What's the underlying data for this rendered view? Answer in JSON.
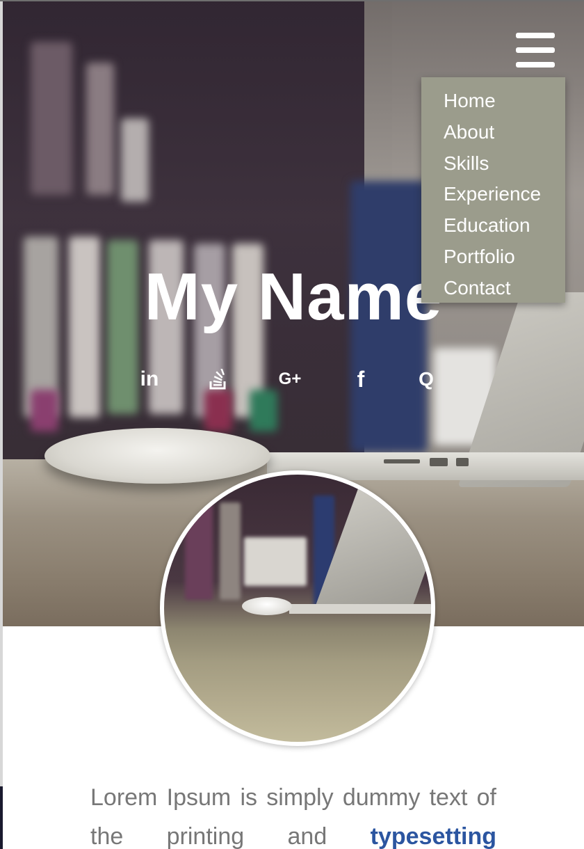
{
  "header": {
    "menu_icon": "hamburger-menu-icon"
  },
  "nav": {
    "items": [
      {
        "label": "Home"
      },
      {
        "label": "About"
      },
      {
        "label": "Skills"
      },
      {
        "label": "Experience"
      },
      {
        "label": "Education"
      },
      {
        "label": "Portfolio"
      },
      {
        "label": "Contact"
      }
    ]
  },
  "hero": {
    "title": "My Name"
  },
  "social": {
    "linkedin": {
      "icon": "linkedin-icon",
      "glyph": "in"
    },
    "stackoverflow": {
      "icon": "stackoverflow-icon"
    },
    "googleplus": {
      "icon": "google-plus-icon",
      "glyph": "G+"
    },
    "facebook": {
      "icon": "facebook-icon",
      "glyph": "f"
    },
    "quora": {
      "icon": "quora-icon",
      "glyph": "Q"
    }
  },
  "bio": {
    "line1": "Lorem Ipsum is simply dummy text of",
    "line2_part1": "the printing and",
    "link": "typesetting"
  },
  "colors": {
    "dropdown_bg": "#9b9c8c",
    "link": "#2b55a0",
    "body_text": "#777777"
  }
}
